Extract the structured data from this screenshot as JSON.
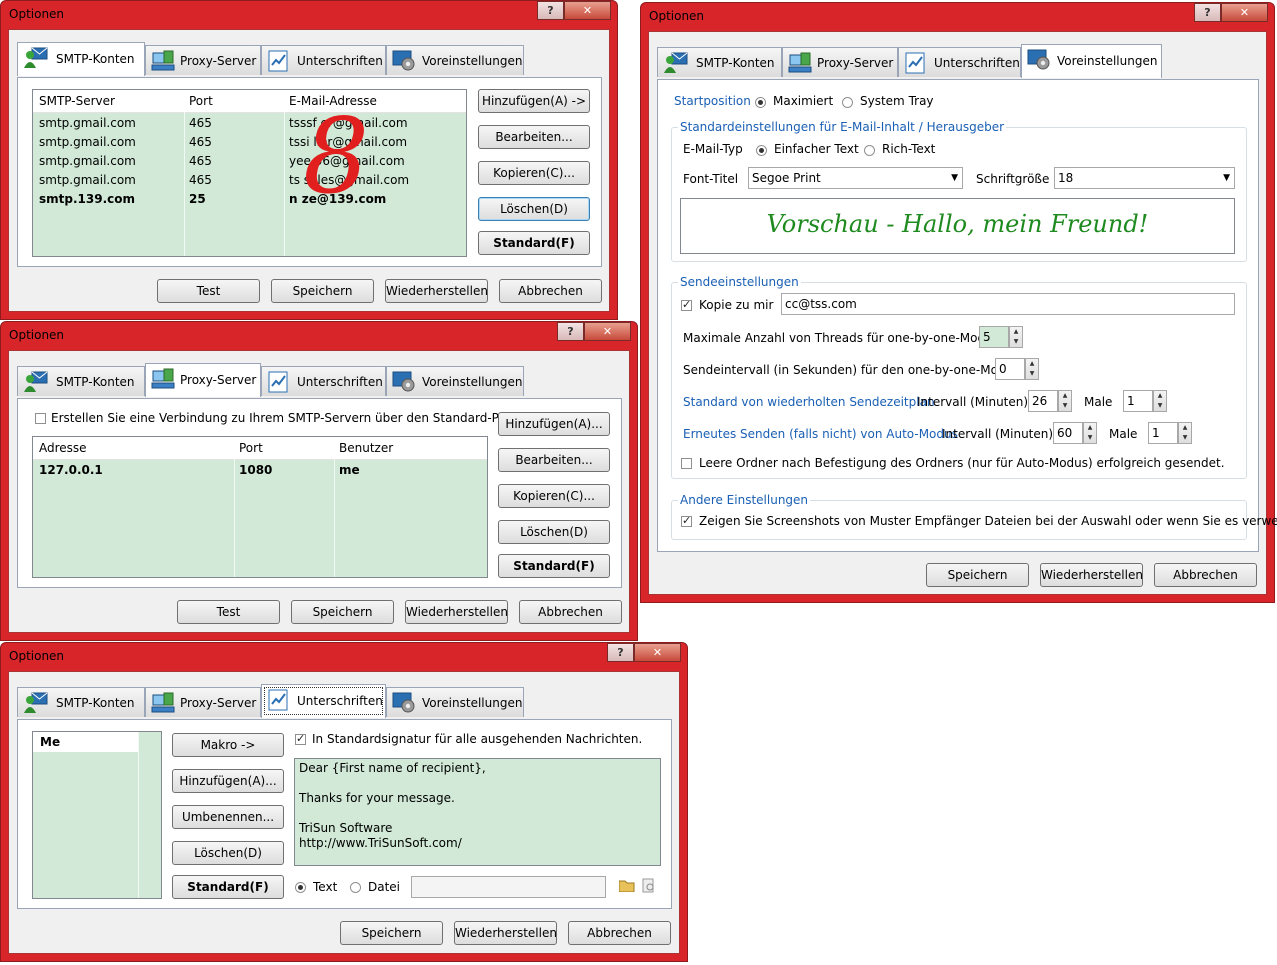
{
  "window_title": "Optionen",
  "caption": {
    "help": "?",
    "close": "✕"
  },
  "tabs": [
    "SMTP-Konten",
    "Proxy-Server",
    "Unterschriften",
    "Voreinstellungen"
  ],
  "footer": {
    "test": "Test",
    "save": "Speichern",
    "restore": "Wiederherstellen",
    "cancel": "Abbrechen"
  },
  "smtp": {
    "columns": [
      "SMTP-Server",
      "Port",
      "E-Mail-Adresse"
    ],
    "rows": [
      {
        "server": "smtp.gmail.com",
        "port": "465",
        "email": "tsssf   er@gmail.com",
        "bold": false
      },
      {
        "server": "smtp.gmail.com",
        "port": "465",
        "email": "tssi   ller@gmail.com",
        "bold": false
      },
      {
        "server": "smtp.gmail.com",
        "port": "465",
        "email": "yee   06@gmail.com",
        "bold": false
      },
      {
        "server": "smtp.gmail.com",
        "port": "465",
        "email": "ts   sales@gmail.com",
        "bold": false
      },
      {
        "server": "smtp.139.com",
        "port": "25",
        "email": "n   ze@139.com",
        "bold": true
      }
    ],
    "buttons": {
      "add": "Hinzufügen(A) ->",
      "edit": "Bearbeiten...",
      "copy": "Kopieren(C)...",
      "delete": "Löschen(D)",
      "default": "Standard(F)"
    },
    "overlay_glyph": "8"
  },
  "proxy": {
    "checkbox_label": "Erstellen Sie eine Verbindung zu Ihrem SMTP-Servern über den Standard-Proxy-Server.",
    "checkbox_checked": false,
    "columns": [
      "Adresse",
      "Port",
      "Benutzer"
    ],
    "rows": [
      {
        "address": "127.0.0.1",
        "port": "1080",
        "user": "me"
      }
    ],
    "buttons": {
      "add": "Hinzufügen(A)...",
      "edit": "Bearbeiten...",
      "copy": "Kopieren(C)...",
      "delete": "Löschen(D)",
      "default": "Standard(F)"
    }
  },
  "signatures": {
    "list": [
      "Me"
    ],
    "buttons": {
      "macro": "Makro ->",
      "add": "Hinzufügen(A)...",
      "rename": "Umbenennen...",
      "delete": "Löschen(D)",
      "default": "Standard(F)"
    },
    "default_checkbox_label": "In Standardsignatur für alle ausgehenden Nachrichten.",
    "default_checked": true,
    "body_lines": [
      "Dear {First name of recipient},",
      "",
      "Thanks for your message.",
      "",
      "TriSun Software",
      "http://www.TriSunSoft.com/"
    ],
    "type_text": "Text",
    "type_file": "Datei",
    "file_value": ""
  },
  "preferences": {
    "startpos_label": "Startposition",
    "startpos_max": "Maximiert",
    "startpos_tray": "System Tray",
    "content_group": "Standardeinstellungen für E-Mail-Inhalt / Herausgeber",
    "mailtype_label": "E-Mail-Typ",
    "mailtype_plain": "Einfacher Text",
    "mailtype_rich": "Rich-Text",
    "font_label": "Font-Titel",
    "font_value": "Segoe Print",
    "size_label": "Schriftgröße",
    "size_value": "18",
    "preview_text": "Vorschau - Hallo, mein Freund!",
    "preview_color": "#1f8a1f",
    "send_group": "Sendeeinstellungen",
    "cc_label": "Kopie zu mir",
    "cc_checked": true,
    "cc_value": "cc@tss.com",
    "threads_label": "Maximale Anzahl von Threads für one-by-one-Modus",
    "threads_value": "5",
    "interval_label": "Sendeintervall (in Sekunden) für den one-by-one-Modus",
    "interval_value": "0",
    "sched_label": "Standard von wiederholten Sendezeitplan",
    "sched_interval_label": "Intervall (Minuten)",
    "sched_interval_value": "26",
    "sched_times_label": "Male",
    "sched_times_value": "1",
    "resend_label": "Erneutes Senden (falls nicht) von Auto-Modus",
    "resend_interval_label": "Intervall (Minuten)",
    "resend_interval_value": "60",
    "resend_times_label": "Male",
    "resend_times_value": "1",
    "empty_folder_label": "Leere Ordner nach Befestigung des Ordners (nur für Auto-Modus) erfolgreich gesendet.",
    "empty_folder_checked": false,
    "other_group": "Andere Einstellungen",
    "screenshot_label": "Zeigen Sie Screenshots von Muster Empfänger Dateien bei der Auswahl oder wenn Sie es verwenden.",
    "screenshot_checked": true
  },
  "colors": {
    "frame": "#d7252a",
    "grid_bg": "#d1e9d6",
    "link": "#1a5fb4"
  }
}
